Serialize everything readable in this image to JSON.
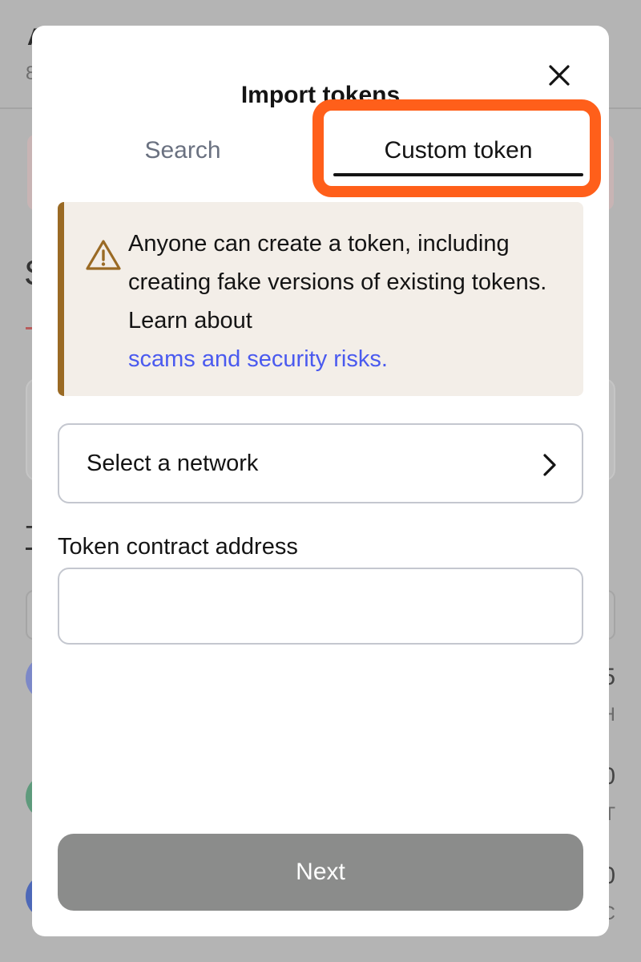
{
  "background": {
    "header_letter": "A",
    "header_sub": "8",
    "section_letter": "S",
    "tokens_letter": "T",
    "rows": [
      {
        "avatar_color": "#7c88c8",
        "value": "5",
        "sub": "H"
      },
      {
        "avatar_color": "#5e9a7c",
        "value": "0",
        "sub": "T"
      },
      {
        "avatar_color": "#4d68b8",
        "value": "0",
        "sub": "C"
      }
    ]
  },
  "modal": {
    "title": "Import tokens",
    "close_icon": "close-icon",
    "tabs": [
      {
        "label": "Search",
        "active": false
      },
      {
        "label": "Custom token",
        "active": true
      }
    ],
    "highlight_color": "#ff5f1a",
    "warning": {
      "icon": "warning-icon",
      "text": "Anyone can create a token, including creating fake versions of existing tokens. Learn about",
      "link": "scams and security risks."
    },
    "network_select": {
      "label": "Select a network",
      "icon": "chevron-right-icon"
    },
    "contract_address": {
      "label": "Token contract address",
      "value": "",
      "placeholder": ""
    },
    "next_button": "Next"
  },
  "colors": {
    "accent_link": "#4a5aef",
    "warning_border": "#9a6a24",
    "warning_bg": "#f3eee8",
    "button_disabled": "#8b8c8b"
  }
}
